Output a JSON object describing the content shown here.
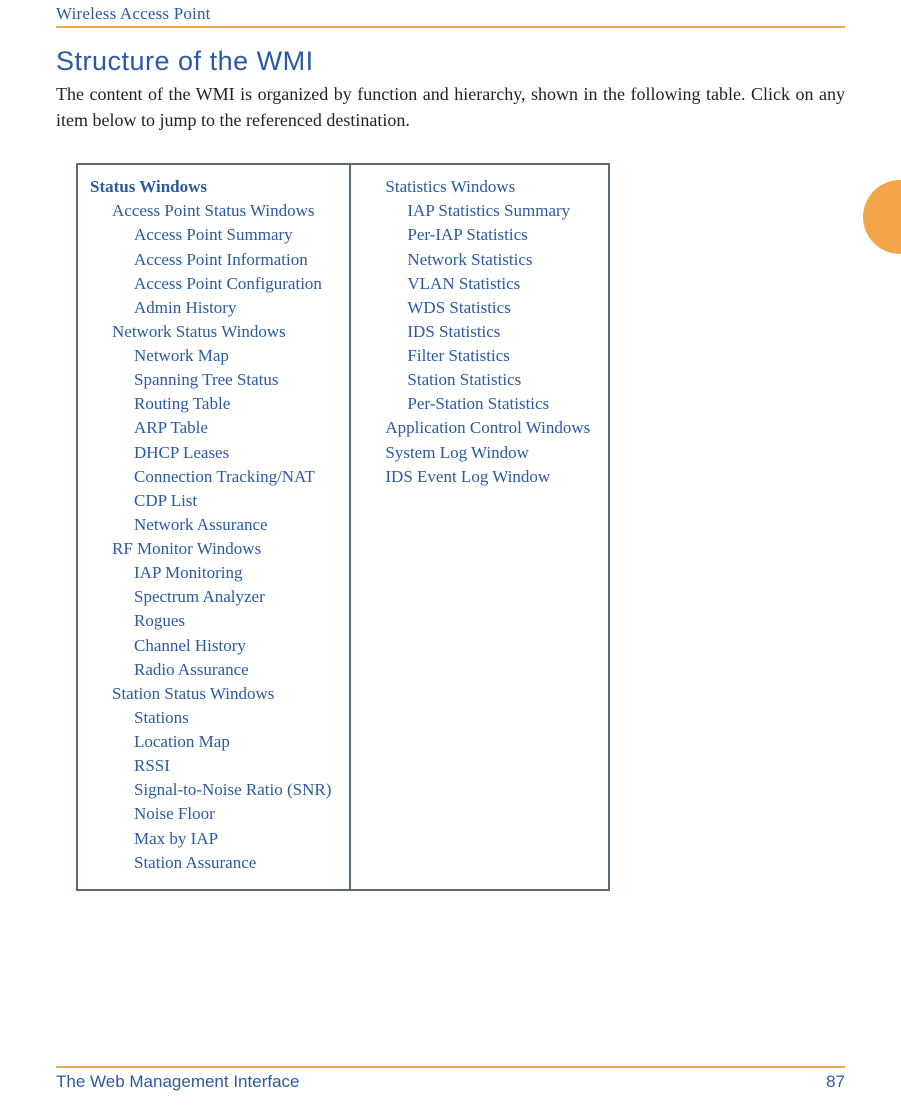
{
  "running_head": "Wireless Access Point",
  "section_title": "Structure of the WMI",
  "body_text": "The content of the WMI is organized by function and hierarchy, shown in the following table. Click on any item below to jump to the referenced destination.",
  "footer_left": "The Web Management Interface",
  "footer_right": "87",
  "toc_left": [
    {
      "level": 0,
      "text": "Status Windows"
    },
    {
      "level": 1,
      "text": "Access Point Status Windows"
    },
    {
      "level": 2,
      "text": "Access Point Summary"
    },
    {
      "level": 2,
      "text": "Access Point Information"
    },
    {
      "level": 2,
      "text": "Access Point Configuration"
    },
    {
      "level": 2,
      "text": "Admin History"
    },
    {
      "level": 1,
      "text": "Network Status Windows"
    },
    {
      "level": 2,
      "text": "Network Map"
    },
    {
      "level": 2,
      "text": "Spanning Tree Status"
    },
    {
      "level": 2,
      "text": "Routing Table"
    },
    {
      "level": 2,
      "text": "ARP Table"
    },
    {
      "level": 2,
      "text": "DHCP Leases"
    },
    {
      "level": 2,
      "text": "Connection Tracking/NAT"
    },
    {
      "level": 2,
      "text": "CDP List"
    },
    {
      "level": 2,
      "text": "Network Assurance"
    },
    {
      "level": 1,
      "text": "RF Monitor Windows"
    },
    {
      "level": 2,
      "text": "IAP Monitoring"
    },
    {
      "level": 2,
      "text": "Spectrum Analyzer"
    },
    {
      "level": 2,
      "text": "Rogues"
    },
    {
      "level": 2,
      "text": "Channel History"
    },
    {
      "level": 2,
      "text": "Radio Assurance"
    },
    {
      "level": 1,
      "text": "Station Status Windows"
    },
    {
      "level": 2,
      "text": "Stations"
    },
    {
      "level": 2,
      "text": "Location Map"
    },
    {
      "level": 2,
      "text": "RSSI"
    },
    {
      "level": 2,
      "text": "Signal-to-Noise Ratio (SNR)"
    },
    {
      "level": 2,
      "text": "Noise Floor"
    },
    {
      "level": 2,
      "text": "Max by IAP"
    },
    {
      "level": 2,
      "text": "Station Assurance"
    }
  ],
  "toc_right": [
    {
      "level": 1,
      "text": "Statistics Windows"
    },
    {
      "level": 2,
      "text": "IAP Statistics Summary"
    },
    {
      "level": 2,
      "text": "Per-IAP Statistics"
    },
    {
      "level": 2,
      "text": "Network Statistics"
    },
    {
      "level": 2,
      "text": "VLAN Statistics"
    },
    {
      "level": 2,
      "text": "WDS Statistics"
    },
    {
      "level": 2,
      "text": "IDS Statistics"
    },
    {
      "level": 2,
      "text": "Filter Statistics"
    },
    {
      "level": 2,
      "text": "Station Statistics"
    },
    {
      "level": 2,
      "text": "Per-Station Statistics"
    },
    {
      "level": 1,
      "text": "Application Control Windows"
    },
    {
      "level": 1,
      "text": "System Log Window"
    },
    {
      "level": 1,
      "text": "IDS Event Log Window"
    }
  ]
}
